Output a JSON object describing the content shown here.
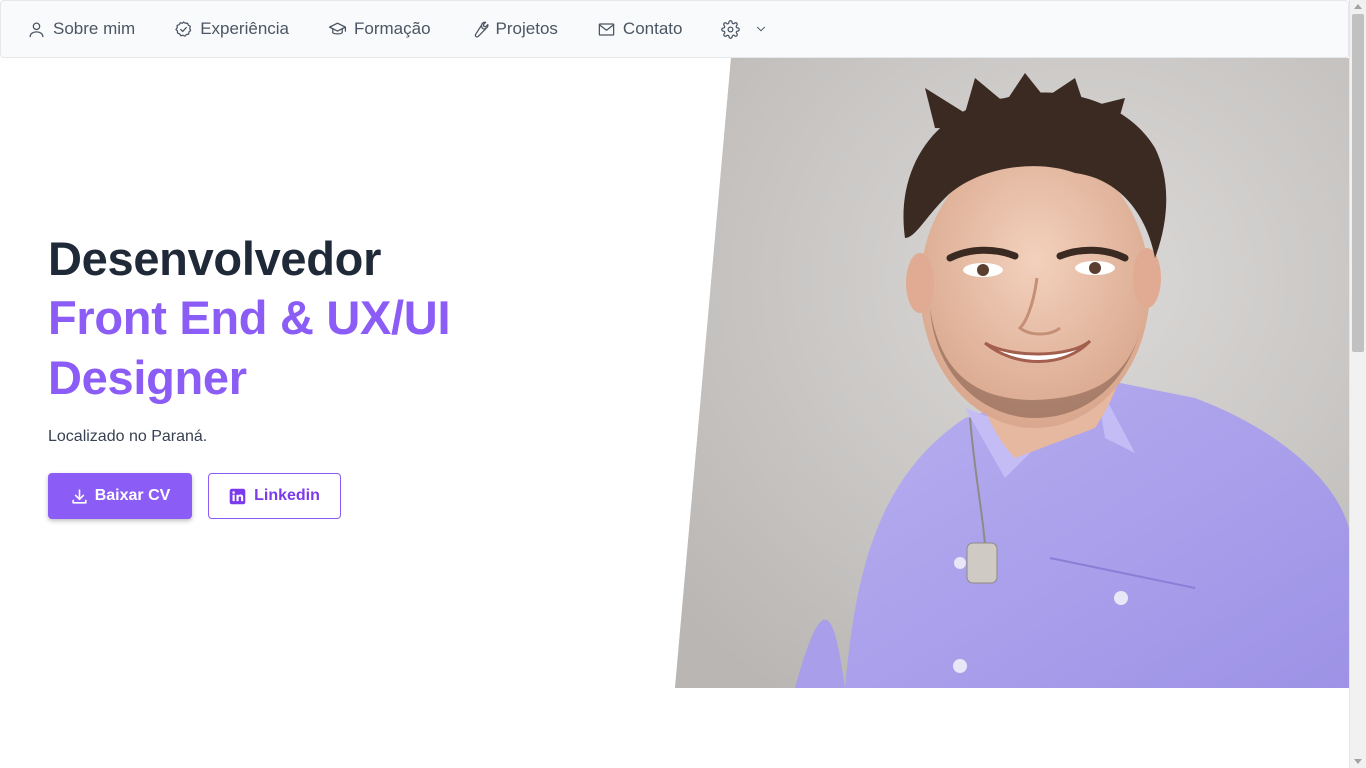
{
  "nav": {
    "items": [
      {
        "label": "Sobre mim",
        "icon": "user-icon"
      },
      {
        "label": "Experiência",
        "icon": "check-circle-icon"
      },
      {
        "label": "Formação",
        "icon": "graduation-cap-icon"
      },
      {
        "label": "Projetos",
        "icon": "wrench-icon"
      },
      {
        "label": "Contato",
        "icon": "mail-icon"
      }
    ],
    "settings_icon": "gear-icon",
    "dropdown_icon": "chevron-down-icon"
  },
  "hero": {
    "title_line1": "Desenvolvedor",
    "title_accent": "Front End & UX/UI Designer",
    "location": "Localizado no Paraná.",
    "download_button": "Baixar CV",
    "linkedin_button": "Linkedin"
  },
  "colors": {
    "accent": "#8b5cf6",
    "text_dark": "#1f2937",
    "nav_bg": "#f9fafb"
  }
}
